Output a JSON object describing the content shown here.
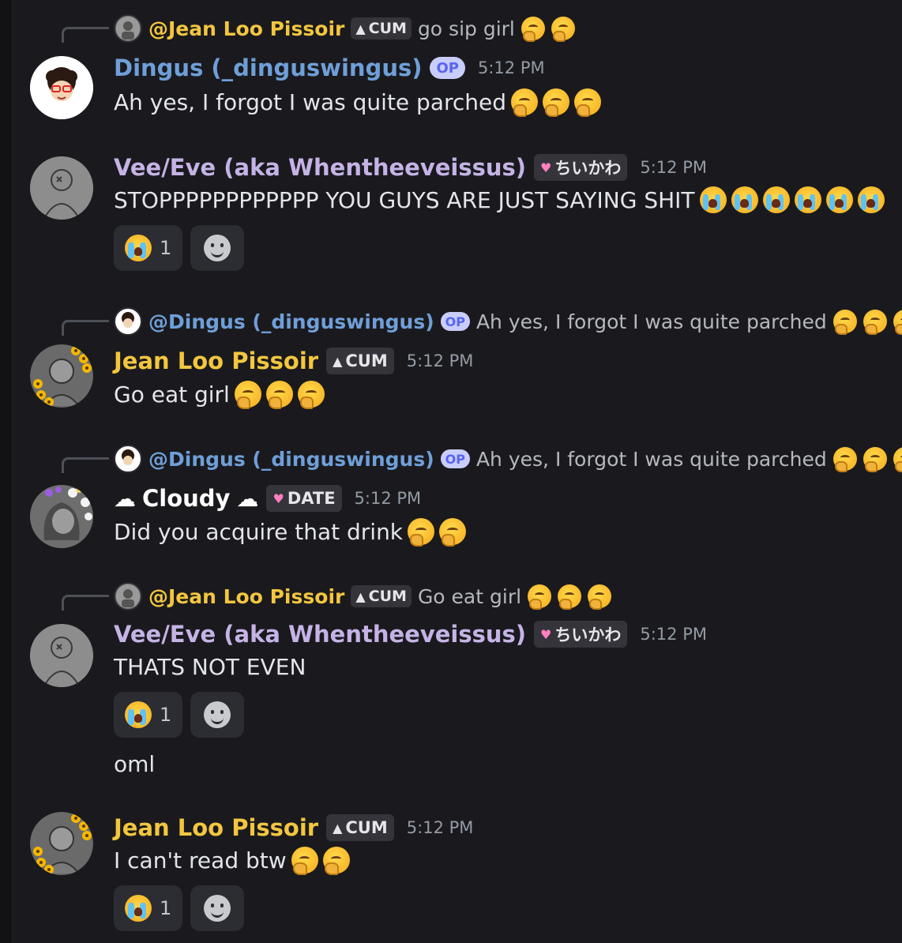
{
  "colors": {
    "dingus": "#6f9fd8",
    "vee": "#c5b3e6",
    "jean": "#f3c63f",
    "cloudy": "#ffffff",
    "background": "#1a1a1e"
  },
  "tags": {
    "cum": "CUM",
    "chiikawa": "ちいかわ",
    "date": "DATE",
    "op": "OP"
  },
  "messages": [
    {
      "reply": {
        "mention": "@Jean Loo Pissoir",
        "tag": "CUM",
        "text": "go sip girl"
      },
      "author": "Dingus (_dinguswingus)",
      "badge": "OP",
      "time": "5:12 PM",
      "content": "Ah yes, I forgot I was quite parched"
    },
    {
      "author": "Vee/Eve (aka Whentheeveissus)",
      "tag": "ちいかわ",
      "time": "5:12 PM",
      "content": "STOPPPPPPPPPPPP YOU GUYS ARE JUST SAYING SHIT",
      "reaction_count": "1"
    },
    {
      "reply": {
        "mention": "@Dingus (_dinguswingus)",
        "badge": "OP",
        "text": "Ah yes, I forgot I was quite parched"
      },
      "author": "Jean Loo Pissoir",
      "tag": "CUM",
      "time": "5:12 PM",
      "content": "Go eat girl"
    },
    {
      "reply": {
        "mention": "@Dingus (_dinguswingus)",
        "badge": "OP",
        "text": "Ah yes, I forgot I was quite parched"
      },
      "author": "Cloudy",
      "tag": "DATE",
      "time": "5:12 PM",
      "content": "Did you acquire that drink"
    },
    {
      "reply": {
        "mention": "@Jean Loo Pissoir",
        "tag": "CUM",
        "text": "Go eat girl"
      },
      "author": "Vee/Eve (aka Whentheeveissus)",
      "tag": "ちいかわ",
      "time": "5:12 PM",
      "content": "THATS NOT EVEN",
      "reaction_count": "1",
      "followup": "oml"
    },
    {
      "author": "Jean Loo Pissoir",
      "tag": "CUM",
      "time": "5:12 PM",
      "content": "I can't read btw",
      "reaction_count": "1"
    }
  ],
  "icons": {
    "think": "thinking-face-emoji",
    "cry": "loudly-crying-face-emoji",
    "add": "add-reaction-icon",
    "cloud": "cloud-emoji",
    "pink_heart": "pink-heart-icon",
    "onigiri": "onigiri-icon"
  }
}
